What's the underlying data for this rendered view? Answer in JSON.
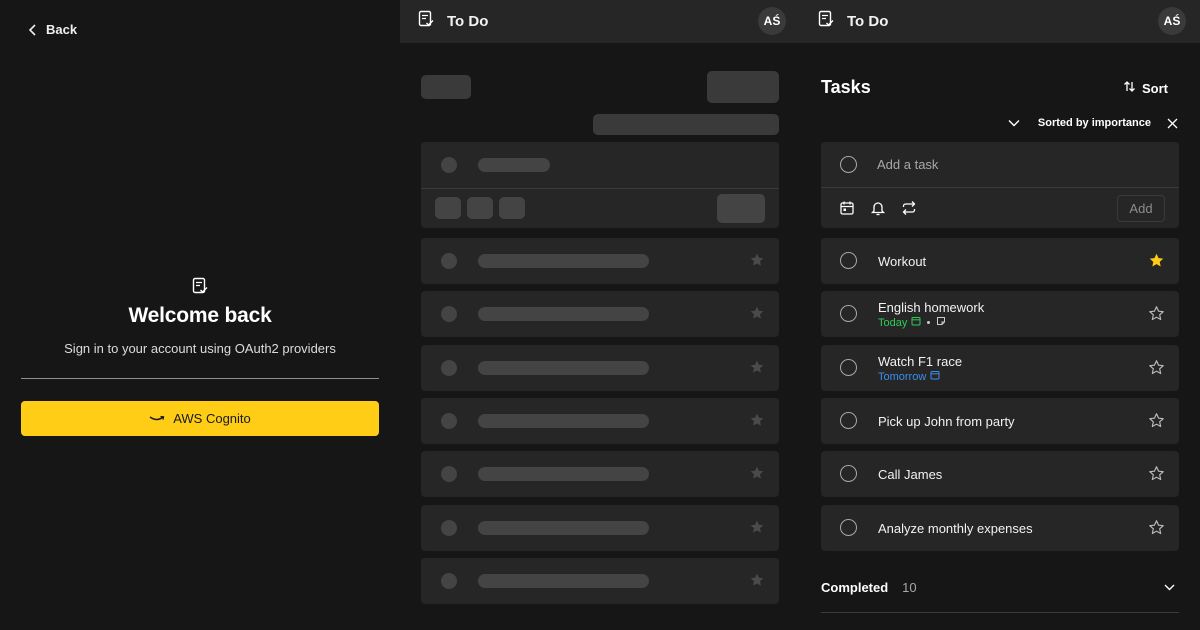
{
  "login": {
    "back_label": "Back",
    "title": "Welcome back",
    "subtitle": "Sign in to your account using OAuth2 providers",
    "provider_button": "AWS Cognito"
  },
  "skeleton": {
    "app_title": "To Do",
    "avatar_initials": "AŚ"
  },
  "tasks": {
    "app_title": "To Do",
    "avatar_initials": "AŚ",
    "heading": "Tasks",
    "sort_label": "Sort",
    "sorted_by": "Sorted by importance",
    "add_placeholder": "Add a task",
    "add_button": "Add",
    "items": [
      {
        "title": "Workout",
        "due": "",
        "starred": true
      },
      {
        "title": "English homework",
        "due": "Today",
        "due_color": "#2ecc55",
        "has_note": true,
        "starred": false
      },
      {
        "title": "Watch F1 race",
        "due": "Tomorrow",
        "due_color": "#3a8ef0",
        "has_note": false,
        "starred": false
      },
      {
        "title": "Pick up John from party",
        "due": "",
        "starred": false
      },
      {
        "title": "Call James",
        "due": "",
        "starred": false
      },
      {
        "title": "Analyze monthly expenses",
        "due": "",
        "starred": false
      }
    ],
    "completed_label": "Completed",
    "completed_count": "10"
  },
  "colors": {
    "accent": "#ffcd16",
    "star": "#ffcd16",
    "background": "#161616",
    "card": "#262626"
  }
}
